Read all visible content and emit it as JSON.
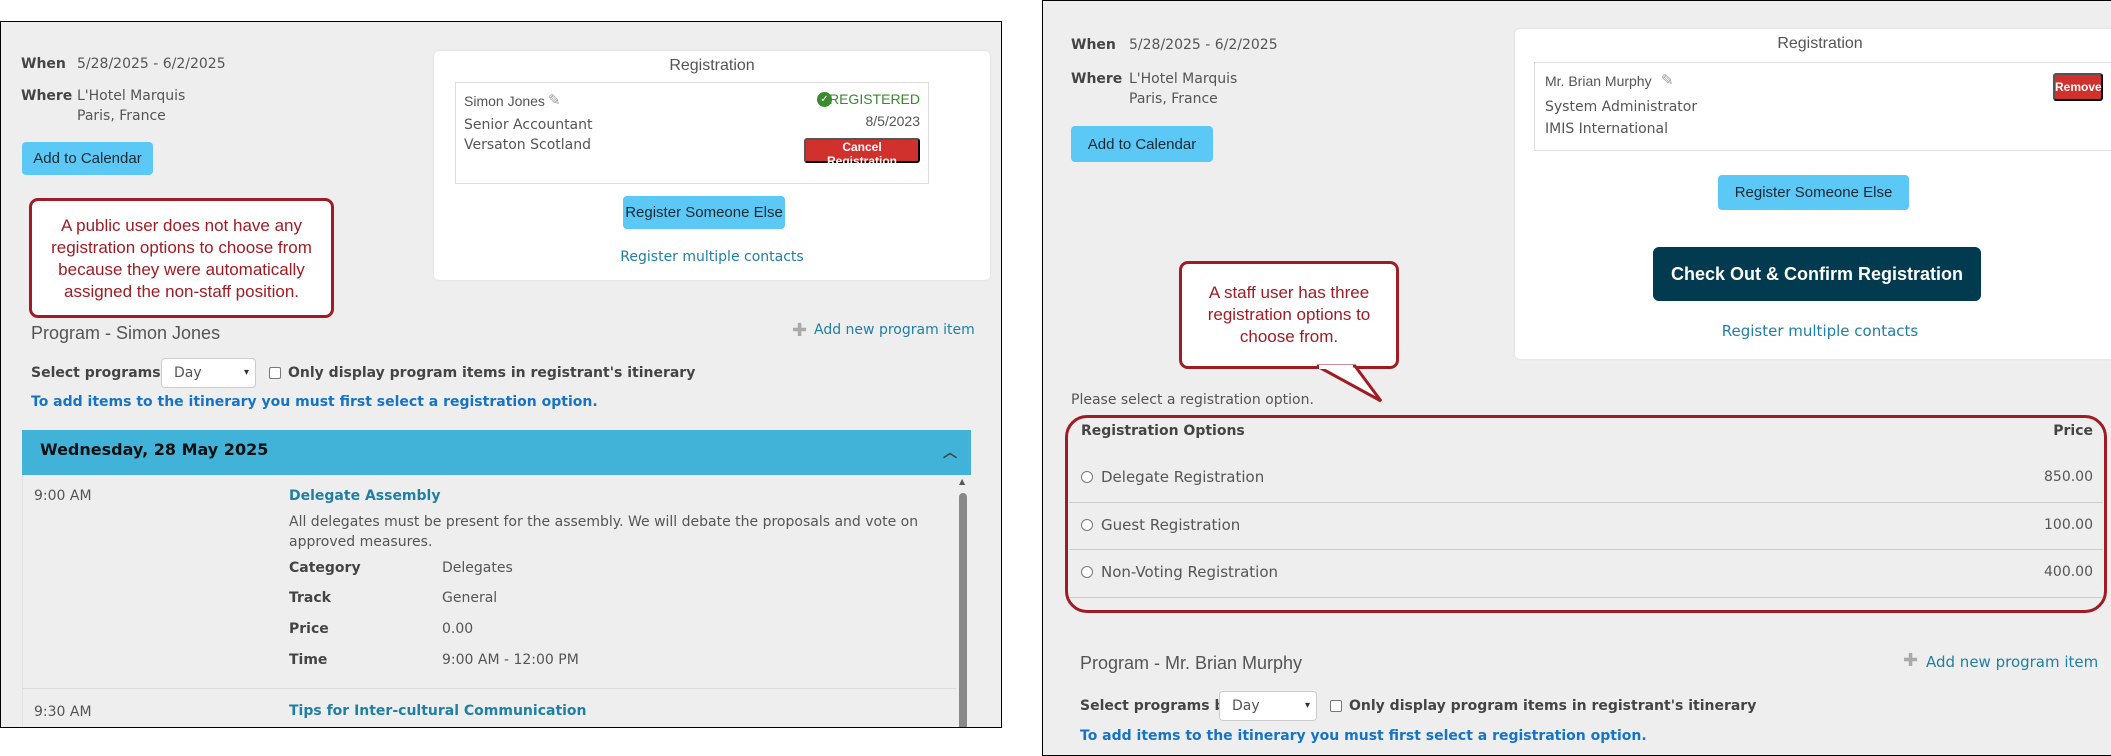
{
  "left": {
    "event": {
      "when_label": "When",
      "when_value": "5/28/2025 - 6/2/2025",
      "where_label": "Where",
      "where_line1": "L'Hotel Marquis",
      "where_line2": "Paris, France",
      "add_calendar": "Add to Calendar"
    },
    "registration": {
      "title": "Registration",
      "name": "Simon Jones",
      "job_title": "Senior Accountant",
      "company": "Versaton Scotland",
      "status": "REGISTERED",
      "date": "8/5/2023",
      "cancel": "Cancel Registration",
      "register_else": "Register Someone Else",
      "register_multiple": "Register multiple contacts"
    },
    "callout": "A public user does not have any registration options to choose from because they were automatically assigned the non-staff position.",
    "program": {
      "title": "Program - Simon Jones",
      "add_item": "Add new program item",
      "select_by_label": "Select programs by",
      "select_value": "Day",
      "only_display": "Only display program items in registrant's itinerary",
      "note": "To add items to the itinerary you must first select a registration option.",
      "day_header": "Wednesday, 28 May 2025",
      "items": [
        {
          "time": "9:00 AM",
          "title": "Delegate Assembly",
          "description": "All delegates must be present for the assembly. We will debate the proposals and vote on approved measures.",
          "details": [
            {
              "label": "Category",
              "value": "Delegates"
            },
            {
              "label": "Track",
              "value": "General"
            },
            {
              "label": "Price",
              "value": "0.00"
            },
            {
              "label": "Time",
              "value": "9:00 AM - 12:00 PM"
            }
          ]
        },
        {
          "time": "9:30 AM",
          "title": "Tips for Inter-cultural Communication"
        }
      ]
    }
  },
  "right": {
    "event": {
      "when_label": "When",
      "when_value": "5/28/2025 - 6/2/2025",
      "where_label": "Where",
      "where_line1": "L'Hotel Marquis",
      "where_line2": "Paris, France",
      "add_calendar": "Add to Calendar"
    },
    "registration": {
      "title": "Registration",
      "name": "Mr. Brian Murphy",
      "job_title": "System Administrator",
      "company": "IMIS International",
      "remove": "Remove",
      "register_else": "Register Someone Else",
      "checkout": "Check Out & Confirm Registration",
      "register_multiple": "Register multiple contacts"
    },
    "callout": "A staff user has three registration options to choose from.",
    "options": {
      "prompt": "Please select a registration option.",
      "header_name": "Registration Options",
      "header_price": "Price",
      "rows": [
        {
          "name": "Delegate Registration",
          "price": "850.00"
        },
        {
          "name": "Guest Registration",
          "price": "100.00"
        },
        {
          "name": "Non-Voting Registration",
          "price": "400.00"
        }
      ]
    },
    "program": {
      "title": "Program - Mr. Brian Murphy",
      "add_item": "Add new program item",
      "select_by_label": "Select programs by",
      "select_value": "Day",
      "only_display": "Only display program items in registrant's itinerary",
      "note": "To add items to the itinerary you must first select a registration option."
    }
  },
  "colors": {
    "accent_light_blue": "#5bc8f5",
    "day_bar": "#41b3d9",
    "danger": "#d0312d",
    "checkout_dark": "#023a4f",
    "callout_red": "#a01c24",
    "registered_green": "#3a8a2e",
    "link": "#1f7fa6"
  }
}
